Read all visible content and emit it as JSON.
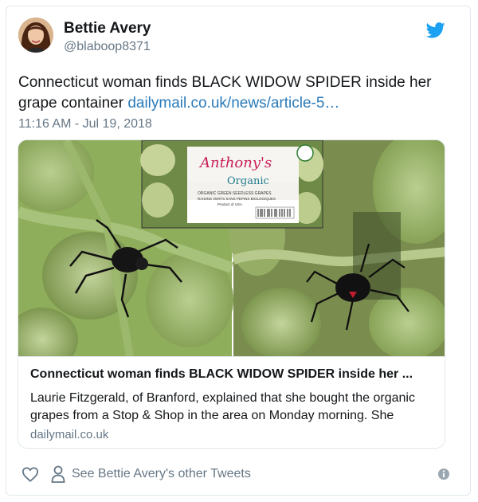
{
  "author": {
    "name": "Bettie Avery",
    "handle": "@blaboop8371"
  },
  "tweet": {
    "text": "Connecticut woman finds BLACK WIDOW SPIDER inside her grape container ",
    "link": "dailymail.co.uk/news/article-5…",
    "timestamp": "11:16 AM - Jul 19, 2018"
  },
  "card": {
    "title": "Connecticut woman finds BLACK WIDOW SPIDER inside her ...",
    "description": "Laurie Fitzgerald, of Branford, explained that she bought the organic grapes from a Stop & Shop in the area on Monday morning. She",
    "domain": "dailymail.co.uk",
    "package_label": {
      "brand": "Anthony's",
      "product": "Organic",
      "subtitle": "ORGANIC GREEN SEEDLESS GRAPES",
      "subtitle2": "RAISINS VERTS SANS PEPINS BIOLOGIQUES",
      "origin": "Product of USA",
      "badge": "USDA ORGANIC"
    }
  },
  "footer": {
    "other_tweets": "See Bettie Avery's other Tweets"
  },
  "colors": {
    "twitter_blue": "#1da1f2",
    "link_blue": "#2b7bb9",
    "muted_gray": "#657786"
  },
  "icons": [
    "twitter-bird-icon",
    "heart-icon",
    "person-icon",
    "info-icon"
  ]
}
